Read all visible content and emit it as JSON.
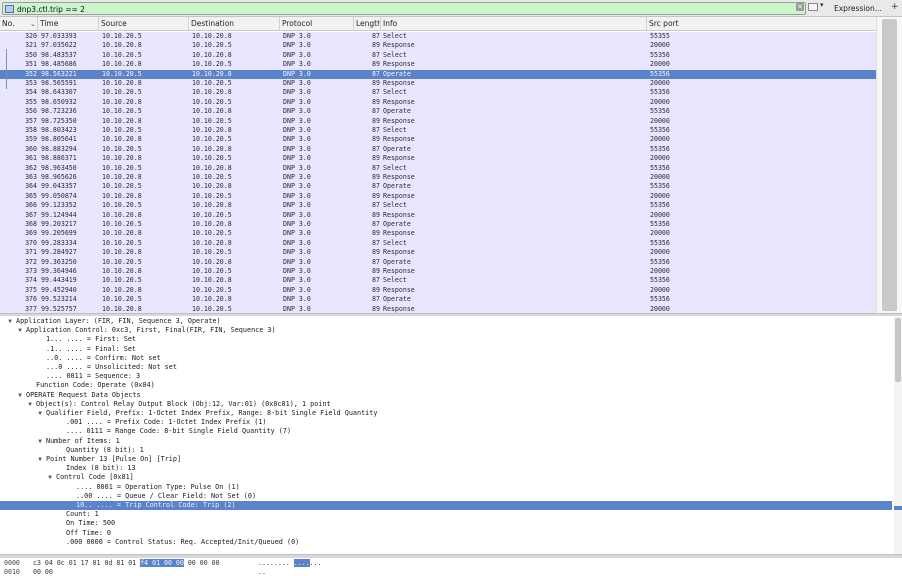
{
  "filter": {
    "value": "dnp3.ctl.trip == 2",
    "expression_label": "Expression...",
    "add_label": "+"
  },
  "columns": [
    "No.",
    "Time",
    "Source",
    "Destination",
    "Protocol",
    "Length",
    "Info",
    "Src port"
  ],
  "packets": [
    {
      "no": "320",
      "time": "97.033393",
      "src": "10.10.20.5",
      "dst": "10.10.20.8",
      "proto": "DNP 3.0",
      "len": "87",
      "info": "Select",
      "sport": "55355"
    },
    {
      "no": "321",
      "time": "97.035622",
      "src": "10.10.20.8",
      "dst": "10.10.20.5",
      "proto": "DNP 3.0",
      "len": "89",
      "info": "Response",
      "sport": "20000"
    },
    {
      "no": "350",
      "time": "98.483537",
      "src": "10.10.20.5",
      "dst": "10.10.20.8",
      "proto": "DNP 3.0",
      "len": "87",
      "info": "Select",
      "sport": "55356"
    },
    {
      "no": "351",
      "time": "98.485686",
      "src": "10.10.20.8",
      "dst": "10.10.20.5",
      "proto": "DNP 3.0",
      "len": "89",
      "info": "Response",
      "sport": "20000"
    },
    {
      "no": "352",
      "time": "98.563221",
      "src": "10.10.20.5",
      "dst": "10.10.20.8",
      "proto": "DNP 3.0",
      "len": "87",
      "info": "Operate",
      "sport": "55356",
      "selected": true
    },
    {
      "no": "353",
      "time": "98.565591",
      "src": "10.10.20.8",
      "dst": "10.10.20.5",
      "proto": "DNP 3.0",
      "len": "89",
      "info": "Response",
      "sport": "20000"
    },
    {
      "no": "354",
      "time": "98.643307",
      "src": "10.10.20.5",
      "dst": "10.10.20.8",
      "proto": "DNP 3.0",
      "len": "87",
      "info": "Select",
      "sport": "55356"
    },
    {
      "no": "355",
      "time": "98.650932",
      "src": "10.10.20.8",
      "dst": "10.10.20.5",
      "proto": "DNP 3.0",
      "len": "89",
      "info": "Response",
      "sport": "20000"
    },
    {
      "no": "356",
      "time": "98.723236",
      "src": "10.10.20.5",
      "dst": "10.10.20.8",
      "proto": "DNP 3.0",
      "len": "87",
      "info": "Operate",
      "sport": "55356"
    },
    {
      "no": "357",
      "time": "98.725350",
      "src": "10.10.20.8",
      "dst": "10.10.20.5",
      "proto": "DNP 3.0",
      "len": "89",
      "info": "Response",
      "sport": "20000"
    },
    {
      "no": "358",
      "time": "98.803423",
      "src": "10.10.20.5",
      "dst": "10.10.20.8",
      "proto": "DNP 3.0",
      "len": "87",
      "info": "Select",
      "sport": "55356"
    },
    {
      "no": "359",
      "time": "98.805641",
      "src": "10.10.20.8",
      "dst": "10.10.20.5",
      "proto": "DNP 3.0",
      "len": "89",
      "info": "Response",
      "sport": "20000"
    },
    {
      "no": "360",
      "time": "98.883294",
      "src": "10.10.20.5",
      "dst": "10.10.20.8",
      "proto": "DNP 3.0",
      "len": "87",
      "info": "Operate",
      "sport": "55356"
    },
    {
      "no": "361",
      "time": "98.886371",
      "src": "10.10.20.8",
      "dst": "10.10.20.5",
      "proto": "DNP 3.0",
      "len": "89",
      "info": "Response",
      "sport": "20000"
    },
    {
      "no": "362",
      "time": "98.963450",
      "src": "10.10.20.5",
      "dst": "10.10.20.8",
      "proto": "DNP 3.0",
      "len": "87",
      "info": "Select",
      "sport": "55356"
    },
    {
      "no": "363",
      "time": "98.965626",
      "src": "10.10.20.8",
      "dst": "10.10.20.5",
      "proto": "DNP 3.0",
      "len": "89",
      "info": "Response",
      "sport": "20000"
    },
    {
      "no": "364",
      "time": "99.043357",
      "src": "10.10.20.5",
      "dst": "10.10.20.8",
      "proto": "DNP 3.0",
      "len": "87",
      "info": "Operate",
      "sport": "55356"
    },
    {
      "no": "365",
      "time": "99.050874",
      "src": "10.10.20.8",
      "dst": "10.10.20.5",
      "proto": "DNP 3.0",
      "len": "89",
      "info": "Response",
      "sport": "20000"
    },
    {
      "no": "366",
      "time": "99.123352",
      "src": "10.10.20.5",
      "dst": "10.10.20.8",
      "proto": "DNP 3.0",
      "len": "87",
      "info": "Select",
      "sport": "55356"
    },
    {
      "no": "367",
      "time": "99.124944",
      "src": "10.10.20.8",
      "dst": "10.10.20.5",
      "proto": "DNP 3.0",
      "len": "89",
      "info": "Response",
      "sport": "20000"
    },
    {
      "no": "368",
      "time": "99.203217",
      "src": "10.10.20.5",
      "dst": "10.10.20.8",
      "proto": "DNP 3.0",
      "len": "87",
      "info": "Operate",
      "sport": "55356"
    },
    {
      "no": "369",
      "time": "99.205699",
      "src": "10.10.20.8",
      "dst": "10.10.20.5",
      "proto": "DNP 3.0",
      "len": "89",
      "info": "Response",
      "sport": "20000"
    },
    {
      "no": "370",
      "time": "99.283334",
      "src": "10.10.20.5",
      "dst": "10.10.20.8",
      "proto": "DNP 3.0",
      "len": "87",
      "info": "Select",
      "sport": "55356"
    },
    {
      "no": "371",
      "time": "99.284927",
      "src": "10.10.20.8",
      "dst": "10.10.20.5",
      "proto": "DNP 3.0",
      "len": "89",
      "info": "Response",
      "sport": "20000"
    },
    {
      "no": "372",
      "time": "99.363250",
      "src": "10.10.20.5",
      "dst": "10.10.20.8",
      "proto": "DNP 3.0",
      "len": "87",
      "info": "Operate",
      "sport": "55356"
    },
    {
      "no": "373",
      "time": "99.364946",
      "src": "10.10.20.8",
      "dst": "10.10.20.5",
      "proto": "DNP 3.0",
      "len": "89",
      "info": "Response",
      "sport": "20000"
    },
    {
      "no": "374",
      "time": "99.443419",
      "src": "10.10.20.5",
      "dst": "10.10.20.8",
      "proto": "DNP 3.0",
      "len": "87",
      "info": "Select",
      "sport": "55356"
    },
    {
      "no": "375",
      "time": "99.452940",
      "src": "10.10.20.8",
      "dst": "10.10.20.5",
      "proto": "DNP 3.0",
      "len": "89",
      "info": "Response",
      "sport": "20000"
    },
    {
      "no": "376",
      "time": "99.523214",
      "src": "10.10.20.5",
      "dst": "10.10.20.8",
      "proto": "DNP 3.0",
      "len": "87",
      "info": "Operate",
      "sport": "55356"
    },
    {
      "no": "377",
      "time": "99.525757",
      "src": "10.10.20.8",
      "dst": "10.10.20.5",
      "proto": "DNP 3.0",
      "len": "89",
      "info": "Response",
      "sport": "20000"
    }
  ],
  "details": [
    {
      "depth": 0,
      "toggle": "open",
      "text": "Application Layer: (FIR, FIN, Sequence 3, Operate)"
    },
    {
      "depth": 1,
      "toggle": "open",
      "text": "Application Control: 0xc3, First, Final(FIR, FIN, Sequence 3)"
    },
    {
      "depth": 2,
      "toggle": "",
      "text": "1... .... = First: Set"
    },
    {
      "depth": 2,
      "toggle": "",
      "text": ".1.. .... = Final: Set"
    },
    {
      "depth": 2,
      "toggle": "",
      "text": "..0. .... = Confirm: Not set"
    },
    {
      "depth": 2,
      "toggle": "",
      "text": "...0 .... = Unsolicited: Not set"
    },
    {
      "depth": 2,
      "toggle": "",
      "text": ".... 0011 = Sequence: 3"
    },
    {
      "depth": 1,
      "toggle": "",
      "text": "Function Code: Operate (0x04)"
    },
    {
      "depth": 1,
      "toggle": "open",
      "text": "OPERATE Request Data Objects"
    },
    {
      "depth": 2,
      "toggle": "open",
      "text": "Object(s): Control Relay Output Block (Obj:12, Var:01) (0x0c01), 1 point"
    },
    {
      "depth": 3,
      "toggle": "open",
      "text": "Qualifier Field, Prefix: 1-Octet Index Prefix, Range: 8-bit Single Field Quantity"
    },
    {
      "depth": 4,
      "toggle": "",
      "text": ".001 .... = Prefix Code: 1-Octet Index Prefix (1)"
    },
    {
      "depth": 4,
      "toggle": "",
      "text": ".... 0111 = Range Code: 8-bit Single Field Quantity (7)"
    },
    {
      "depth": 3,
      "toggle": "open",
      "text": "Number of Items: 1"
    },
    {
      "depth": 4,
      "toggle": "",
      "text": "Quantity (8 bit): 1"
    },
    {
      "depth": 3,
      "toggle": "open",
      "text": "Point Number 13 [Pulse On] [Trip]"
    },
    {
      "depth": 4,
      "toggle": "",
      "text": "Index (8 bit): 13"
    },
    {
      "depth": 4,
      "toggle": "open",
      "text": "Control Code [0x81]"
    },
    {
      "depth": 5,
      "toggle": "",
      "text": ".... 0001 = Operation Type: Pulse On (1)"
    },
    {
      "depth": 5,
      "toggle": "",
      "text": "..00 .... = Queue / Clear Field: Not Set (0)"
    },
    {
      "depth": 5,
      "toggle": "",
      "text": "10.. .... = Trip Control Code: Trip (2)",
      "selected": true
    },
    {
      "depth": 4,
      "toggle": "",
      "text": "Count: 1"
    },
    {
      "depth": 4,
      "toggle": "",
      "text": "On Time: 500"
    },
    {
      "depth": 4,
      "toggle": "",
      "text": "Off Time: 0"
    },
    {
      "depth": 4,
      "toggle": "",
      "text": ".000 0000 = Control Status: Req. Accepted/Init/Queued (0)"
    }
  ],
  "bytes": [
    {
      "offset": "0000",
      "hex_before": "c3 04 0c 01 17 01 0d 81  01 ",
      "hex_hl": "f4 01 00 00",
      "hex_after": " 00 00 00",
      "ascii_before": "........ ",
      "ascii_hl": "....",
      "ascii_after": "..."
    },
    {
      "offset": "0010",
      "hex_before": "00 00",
      "hex_hl": "",
      "hex_after": "",
      "ascii_before": "..",
      "ascii_hl": "",
      "ascii_after": ""
    }
  ],
  "colors": {
    "row_bg": "#e8e6fc",
    "selection": "#5b83c9",
    "filter_valid": "#ccf5cc"
  }
}
